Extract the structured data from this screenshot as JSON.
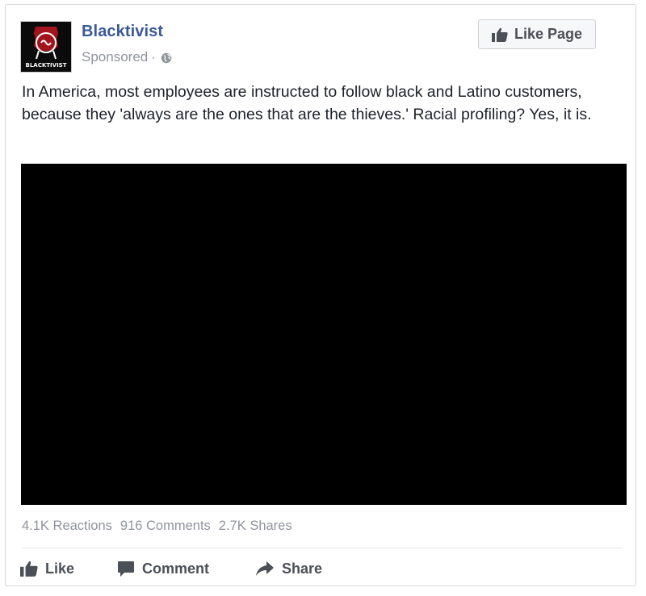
{
  "post": {
    "page_name": "Blacktivist",
    "sponsored_label": "Sponsored",
    "meta_separator": "·",
    "avatar_text": "BLACKTIVIST",
    "like_page_label": "Like Page",
    "body_text": "In America, most employees are instructed to follow black and Latino customers, because they 'always are the ones that are the thieves.' Racial profiling? Yes, it is."
  },
  "stats": {
    "reactions": "4.1K Reactions",
    "comments": "916 Comments",
    "shares": "2.7K Shares"
  },
  "actions": {
    "like_label": "Like",
    "comment_label": "Comment",
    "share_label": "Share"
  },
  "colors": {
    "page_name": "#3b5998",
    "meta_text": "#90949c",
    "body_text": "#1d2129",
    "action_text": "#4b4f56",
    "video_bg": "#000000",
    "avatar_accent": "#a3131d"
  },
  "icons": {
    "avatar": "blacktivist-logo",
    "globe": "globe-icon",
    "like_page": "thumbs-up-icon",
    "like": "thumbs-up-icon",
    "comment": "comment-bubble-icon",
    "share": "share-arrow-icon"
  }
}
